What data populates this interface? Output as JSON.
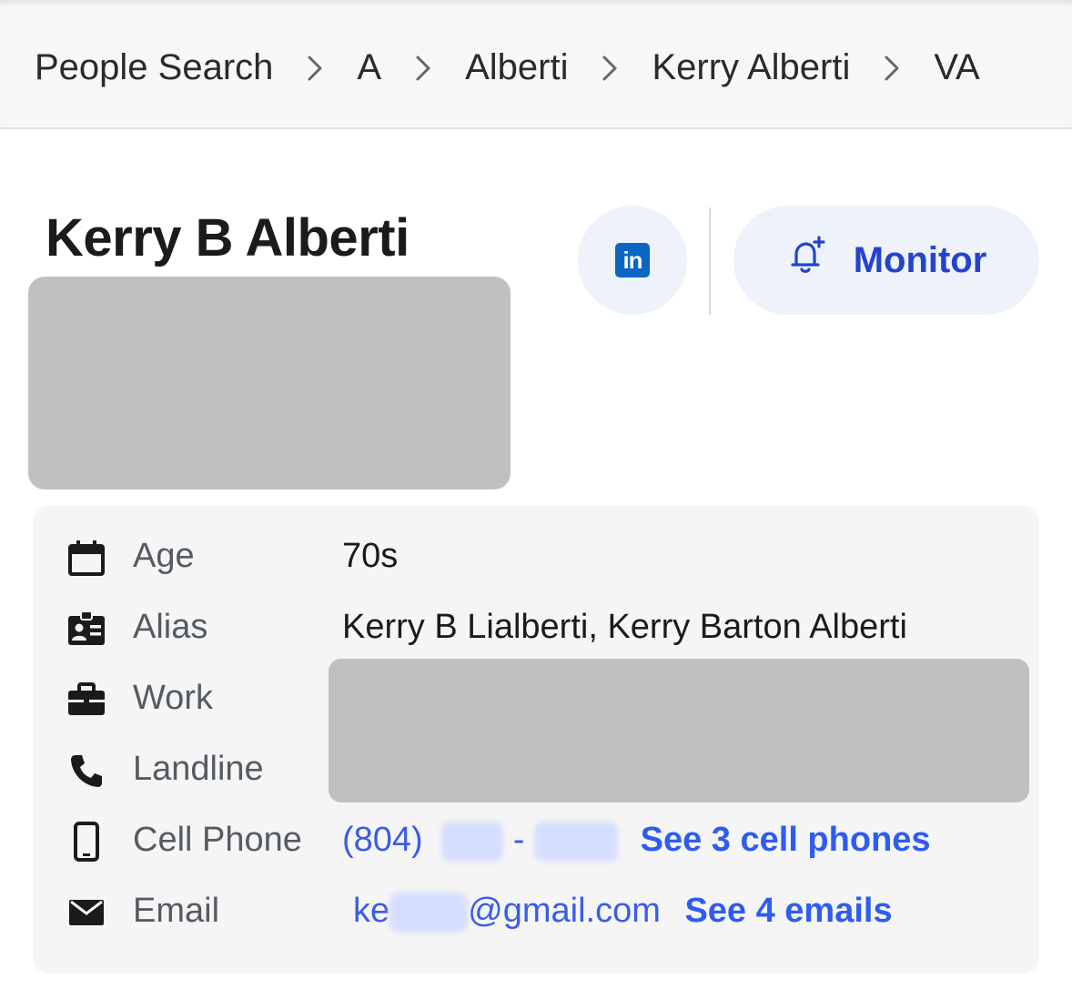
{
  "breadcrumb": {
    "items": [
      "People Search",
      "A",
      "Alberti",
      "Kerry Alberti",
      "VA"
    ]
  },
  "profile": {
    "name": "Kerry B Alberti",
    "monitor_label": "Monitor",
    "linkedin_label": "in"
  },
  "details": {
    "age": {
      "label": "Age",
      "value": "70s"
    },
    "alias": {
      "label": "Alias",
      "value": "Kerry B Lialberti, Kerry Barton Alberti"
    },
    "work": {
      "label": "Work"
    },
    "landline": {
      "label": "Landline"
    },
    "cell": {
      "label": "Cell Phone",
      "area_code": "(804)",
      "dash": "-",
      "see_more": "See 3 cell phones"
    },
    "email": {
      "label": "Email",
      "prefix": "ke",
      "domain": "@gmail.com",
      "see_more": "See 4 emails"
    }
  },
  "colors": {
    "link": "#3a5de6",
    "accent": "#2444c9",
    "linkedin": "#0a66c2",
    "redaction": "#c0c0c0"
  }
}
